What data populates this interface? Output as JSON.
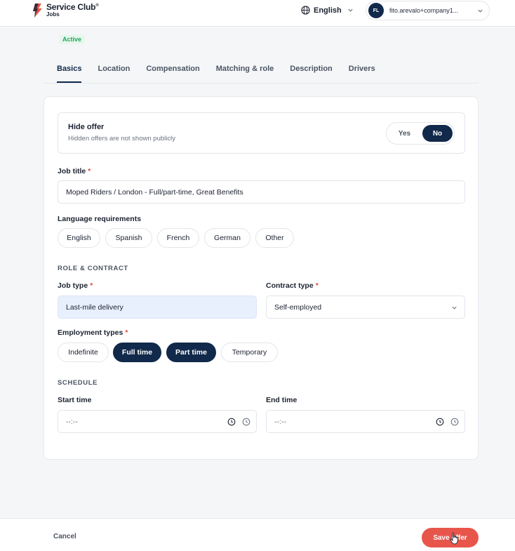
{
  "header": {
    "brand_title": "Service Club",
    "brand_sup": "®",
    "brand_sub": "Jobs",
    "language": "English",
    "user_initials": "FL",
    "user_email": "fito.arevalo+company1..."
  },
  "status": "Active",
  "tabs": [
    {
      "label": "Basics",
      "active": true
    },
    {
      "label": "Location"
    },
    {
      "label": "Compensation"
    },
    {
      "label": "Matching & role"
    },
    {
      "label": "Description"
    },
    {
      "label": "Drivers"
    }
  ],
  "hide_offer": {
    "title": "Hide offer",
    "description": "Hidden offers are not shown publicly",
    "yes_label": "Yes",
    "no_label": "No",
    "selected": "No"
  },
  "job_title": {
    "label": "Job title",
    "required": "*",
    "value": "Moped Riders / London - Full/part-time, Great Benefits"
  },
  "language_requirements": {
    "label": "Language requirements",
    "options": [
      "English",
      "Spanish",
      "French",
      "German",
      "Other"
    ]
  },
  "role_contract": {
    "section_title": "ROLE & CONTRACT",
    "job_type_label": "Job type",
    "job_type_value": "Last-mile delivery",
    "contract_type_label": "Contract type",
    "contract_type_value": "Self-employed",
    "required": "*"
  },
  "employment_types": {
    "label": "Employment types",
    "required": "*",
    "options": [
      {
        "label": "Indefinite",
        "selected": false
      },
      {
        "label": "Full time",
        "selected": true
      },
      {
        "label": "Part time",
        "selected": true
      },
      {
        "label": "Temporary",
        "selected": false
      }
    ]
  },
  "schedule": {
    "section_title": "SCHEDULE",
    "start_label": "Start time",
    "start_value": "--:--",
    "end_label": "End time",
    "end_value": "--:--"
  },
  "footer": {
    "cancel_label": "Cancel",
    "save_label": "Save offer"
  },
  "colors": {
    "navy": "#11294a",
    "accent_red": "#e8554b",
    "active_green": "#1fa85a"
  }
}
